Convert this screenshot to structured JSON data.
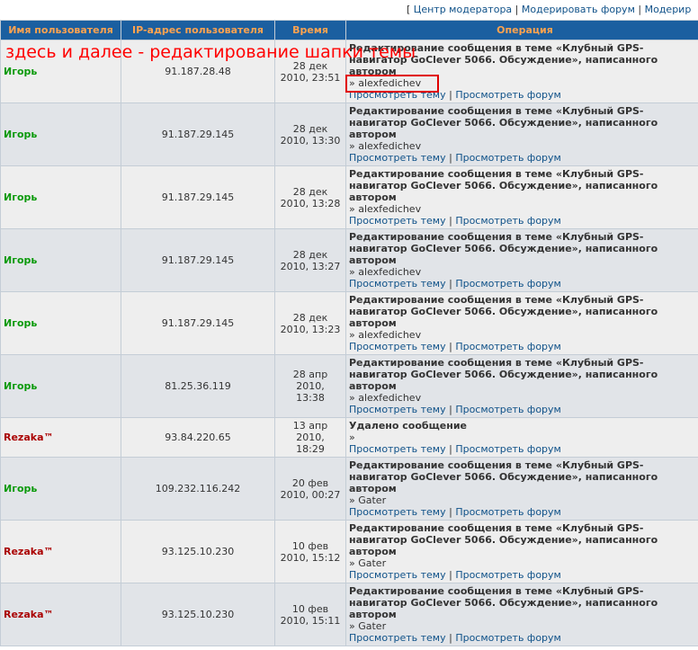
{
  "topnav": {
    "bracket": "[",
    "moderator_center": "Центр модератора",
    "moderate_forum": "Модерировать форум",
    "moderate_more": "Модерир",
    "separator": "|"
  },
  "table": {
    "headers": [
      "Имя пользователя",
      "IP-адрес пользователя",
      "Время",
      "Операция"
    ],
    "view_topic": "Просмотреть тему",
    "view_forum": "Просмотреть форум",
    "link_separator": "|",
    "rows": [
      {
        "user": "Игорь",
        "user_color": "#0a9a0a",
        "ip": "91.187.28.48",
        "time1": "28 дек",
        "time2": "2010, 23:51",
        "op": "Редактирование сообщения в теме «Клубный GPS-навигатор GoClever 5066. Обсуждение», написанного автором",
        "author": "» alexfedichev"
      },
      {
        "user": "Игорь",
        "user_color": "#0a9a0a",
        "ip": "91.187.29.145",
        "time1": "28 дек",
        "time2": "2010, 13:30",
        "op": "Редактирование сообщения в теме «Клубный GPS-навигатор GoClever 5066. Обсуждение», написанного автором",
        "author": "» alexfedichev"
      },
      {
        "user": "Игорь",
        "user_color": "#0a9a0a",
        "ip": "91.187.29.145",
        "time1": "28 дек",
        "time2": "2010, 13:28",
        "op": "Редактирование сообщения в теме «Клубный GPS-навигатор GoClever 5066. Обсуждение», написанного автором",
        "author": "» alexfedichev"
      },
      {
        "user": "Игорь",
        "user_color": "#0a9a0a",
        "ip": "91.187.29.145",
        "time1": "28 дек",
        "time2": "2010, 13:27",
        "op": "Редактирование сообщения в теме «Клубный GPS-навигатор GoClever 5066. Обсуждение», написанного автором",
        "author": "» alexfedichev"
      },
      {
        "user": "Игорь",
        "user_color": "#0a9a0a",
        "ip": "91.187.29.145",
        "time1": "28 дек",
        "time2": "2010, 13:23",
        "op": "Редактирование сообщения в теме «Клубный GPS-навигатор GoClever 5066. Обсуждение», написанного автором",
        "author": "» alexfedichev"
      },
      {
        "user": "Игорь",
        "user_color": "#0a9a0a",
        "ip": "81.25.36.119",
        "time1": "28 апр 2010,",
        "time2": "13:38",
        "op": "Редактирование сообщения в теме «Клубный GPS-навигатор GoClever 5066. Обсуждение», написанного автором",
        "author": "» alexfedichev"
      },
      {
        "user": "Rezaka™",
        "user_color": "#aa0000",
        "ip": "93.84.220.65",
        "time1": "13 апр 2010,",
        "time2": "18:29",
        "op": "Удалено сообщение",
        "author": "»",
        "short": true
      },
      {
        "user": "Игорь",
        "user_color": "#0a9a0a",
        "ip": "109.232.116.242",
        "time1": "20 фев",
        "time2": "2010, 00:27",
        "op": "Редактирование сообщения в теме «Клубный GPS-навигатор GoClever 5066. Обсуждение», написанного автором",
        "author": "» Gater"
      },
      {
        "user": "Rezaka™",
        "user_color": "#aa0000",
        "ip": "93.125.10.230",
        "time1": "10 фев",
        "time2": "2010, 15:12",
        "op": "Редактирование сообщения в теме «Клубный GPS-навигатор GoClever 5066. Обсуждение», написанного автором",
        "author": "» Gater"
      },
      {
        "user": "Rezaka™",
        "user_color": "#aa0000",
        "ip": "93.125.10.230",
        "time1": "10 фев",
        "time2": "2010, 15:11",
        "op": "Редактирование сообщения в теме «Клубный GPS-навигатор GoClever 5066. Обсуждение», написанного автором",
        "author": "» Gater"
      }
    ]
  },
  "annotation": {
    "text": "здесь и далее - редактирование шапки темы",
    "color": "#ff0000"
  }
}
